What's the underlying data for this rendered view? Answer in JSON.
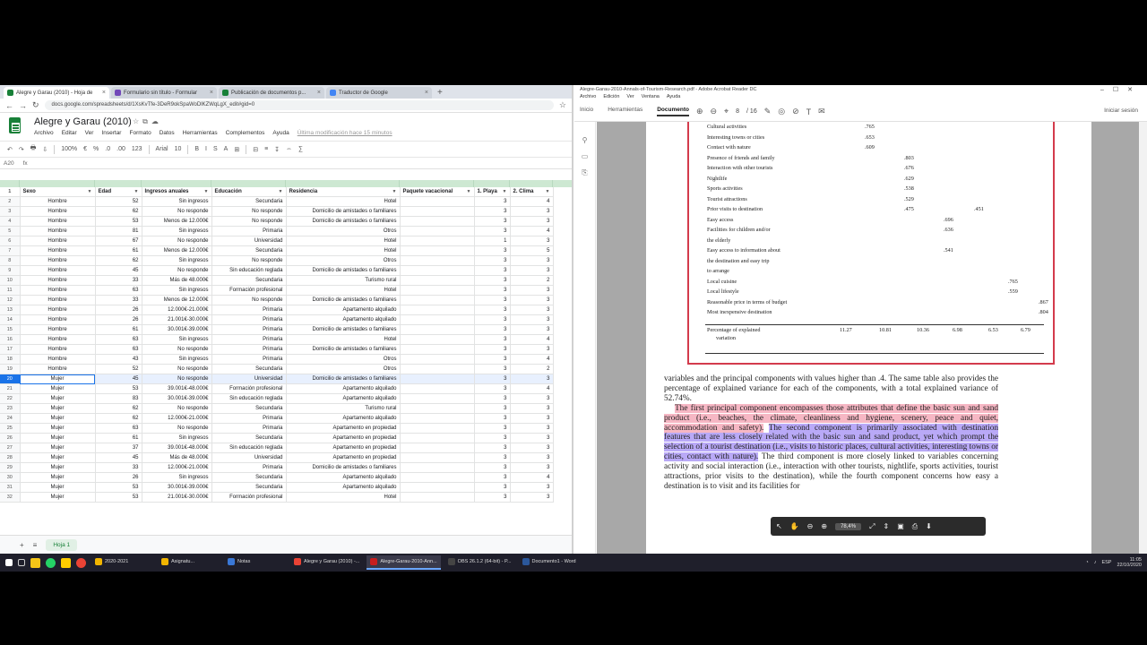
{
  "browser": {
    "tabs": [
      {
        "label": "Alegre y Garau (2010) - Hoja de",
        "color": "#188038",
        "active": true
      },
      {
        "label": "Formulario sin título - Formular",
        "color": "#7248b9",
        "active": false
      },
      {
        "label": "Publicación de documentos p...",
        "color": "#188038",
        "active": false
      },
      {
        "label": "Traductor de Google",
        "color": "#4285f4",
        "active": false
      }
    ],
    "url": "docs.google.com/spreadsheets/d/1XsKvTfe-3DeR9okSpaWoDlKZWqLgX_edit#gid=0"
  },
  "sheet": {
    "title": "Alegre y Garau (2010)",
    "menu": [
      "Archivo",
      "Editar",
      "Ver",
      "Insertar",
      "Formato",
      "Datos",
      "Herramientas",
      "Complementos",
      "Ayuda"
    ],
    "last_edit": "Última modificación hace 15 minutos",
    "toolbar": [
      "↶",
      "↷",
      "🖶",
      "⇩",
      "100%",
      "€",
      "%",
      ".0",
      ".00",
      "123",
      "Arial",
      "10",
      "B",
      "I",
      "S",
      "A",
      "⊞",
      "⊟",
      "≡",
      "↧",
      "⇔",
      "∑"
    ],
    "cell_ref": "A20",
    "columns": [
      "Sexo",
      "Edad",
      "Ingresos anuales",
      "Educación",
      "Residencia",
      "Paquete vacacional",
      "1. Playa",
      "2. Clima"
    ],
    "rows": [
      [
        "Hombre",
        "52",
        "Sin ingresos",
        "Secundaria",
        "Hotel",
        "",
        "3",
        "4"
      ],
      [
        "Hombre",
        "62",
        "No responde",
        "No responde",
        "Domicilio de amistades o familiares",
        "",
        "3",
        "3"
      ],
      [
        "Hombre",
        "53",
        "Menos de 12.000€",
        "No responde",
        "Domicilio de amistades o familiares",
        "",
        "3",
        "3"
      ],
      [
        "Hombre",
        "81",
        "Sin ingresos",
        "Primaria",
        "Otros",
        "",
        "3",
        "4"
      ],
      [
        "Hombre",
        "67",
        "No responde",
        "Universidad",
        "Hotel",
        "",
        "1",
        "3"
      ],
      [
        "Hombre",
        "61",
        "Menos de 12.000€",
        "Secundaria",
        "Hotel",
        "",
        "3",
        "5"
      ],
      [
        "Hombre",
        "62",
        "Sin ingresos",
        "No responde",
        "Otros",
        "",
        "3",
        "3"
      ],
      [
        "Hombre",
        "45",
        "No responde",
        "Sin educación reglada",
        "Domicilio de amistades o familiares",
        "",
        "3",
        "3"
      ],
      [
        "Hombre",
        "33",
        "Más de 48.000€",
        "Secundaria",
        "Turismo rural",
        "",
        "3",
        "2"
      ],
      [
        "Hombre",
        "63",
        "Sin ingresos",
        "Formación profesional",
        "Hotel",
        "",
        "3",
        "3"
      ],
      [
        "Hombre",
        "33",
        "Menos de 12.000€",
        "No responde",
        "Domicilio de amistades o familiares",
        "",
        "3",
        "3"
      ],
      [
        "Hombre",
        "26",
        "12.000€-21.000€",
        "Primaria",
        "Apartamento alquilado",
        "",
        "3",
        "3"
      ],
      [
        "Hombre",
        "26",
        "21.001€-30.000€",
        "Primaria",
        "Apartamento alquilado",
        "",
        "3",
        "3"
      ],
      [
        "Hombre",
        "61",
        "30.001€-39.000€",
        "Primaria",
        "Domicilio de amistades o familiares",
        "",
        "3",
        "3"
      ],
      [
        "Hombre",
        "63",
        "Sin ingresos",
        "Primaria",
        "Hotel",
        "",
        "3",
        "4"
      ],
      [
        "Hombre",
        "63",
        "No responde",
        "Primaria",
        "Domicilio de amistades o familiares",
        "",
        "3",
        "3"
      ],
      [
        "Hombre",
        "43",
        "Sin ingresos",
        "Primaria",
        "Otros",
        "",
        "3",
        "4"
      ],
      [
        "Hombre",
        "52",
        "No responde",
        "Secundaria",
        "Otros",
        "",
        "3",
        "2"
      ],
      [
        "Mujer",
        "45",
        "No responde",
        "Universidad",
        "Domicilio de amistades o familiares",
        "",
        "3",
        "3"
      ],
      [
        "Mujer",
        "53",
        "39.001€-48.000€",
        "Formación profesional",
        "Apartamento alquilado",
        "",
        "3",
        "4"
      ],
      [
        "Mujer",
        "83",
        "30.001€-39.000€",
        "Sin educación reglada",
        "Apartamento alquilado",
        "",
        "3",
        "3"
      ],
      [
        "Mujer",
        "62",
        "No responde",
        "Secundaria",
        "Turismo rural",
        "",
        "3",
        "3"
      ],
      [
        "Mujer",
        "62",
        "12.000€-21.000€",
        "Primaria",
        "Apartamento alquilado",
        "",
        "3",
        "3"
      ],
      [
        "Mujer",
        "63",
        "No responde",
        "Primaria",
        "Apartamento en propiedad",
        "",
        "3",
        "3"
      ],
      [
        "Mujer",
        "61",
        "Sin ingresos",
        "Secundaria",
        "Apartamento en propiedad",
        "",
        "3",
        "3"
      ],
      [
        "Mujer",
        "37",
        "39.001€-48.000€",
        "Sin educación reglada",
        "Apartamento en propiedad",
        "",
        "3",
        "3"
      ],
      [
        "Mujer",
        "45",
        "Más de 48.000€",
        "Universidad",
        "Apartamento en propiedad",
        "",
        "3",
        "3"
      ],
      [
        "Mujer",
        "33",
        "12.000€-21.000€",
        "Primaria",
        "Domicilio de amistades o familiares",
        "",
        "3",
        "3"
      ],
      [
        "Mujer",
        "26",
        "Sin ingresos",
        "Secundaria",
        "Apartamento alquilado",
        "",
        "3",
        "4"
      ],
      [
        "Mujer",
        "53",
        "30.001€-39.000€",
        "Secundaria",
        "Apartamento alquilado",
        "",
        "3",
        "3"
      ],
      [
        "Mujer",
        "53",
        "21.001€-30.000€",
        "Formación profesional",
        "Hotel",
        "",
        "3",
        "3"
      ]
    ],
    "selected_row": 20,
    "sheet_tab": "Hoja 1"
  },
  "pdf": {
    "title": "Alegre-Garau-2010-Annals-of-Tourism-Research.pdf - Adobe Acrobat Reader DC",
    "menu": [
      "Archivo",
      "Edición",
      "Ver",
      "Ventana",
      "Ayuda"
    ],
    "tabs": [
      "Inicio",
      "Herramientas",
      "Documento"
    ],
    "page_num": "8",
    "page_total": "/ 16",
    "signin": "Iniciar sesión",
    "zoom": "78,4%",
    "table_rows": [
      {
        "label": "Cultural activities",
        "vals": [
          ".765",
          "",
          "",
          "",
          "",
          ""
        ]
      },
      {
        "label": "Interesting towns or cities",
        "vals": [
          ".653",
          "",
          "",
          "",
          "",
          ""
        ]
      },
      {
        "label": "Contact with nature",
        "vals": [
          ".609",
          "",
          "",
          "",
          "",
          ""
        ]
      },
      {
        "label": "Presence of friends and family",
        "vals": [
          "",
          ".803",
          "",
          "",
          "",
          ""
        ]
      },
      {
        "label": "Interaction with other tourists",
        "vals": [
          "",
          ".676",
          "",
          "",
          "",
          ""
        ]
      },
      {
        "label": "Nightlife",
        "vals": [
          "",
          ".629",
          "",
          "",
          "",
          ""
        ]
      },
      {
        "label": "Sports activities",
        "vals": [
          "",
          ".538",
          "",
          "",
          "",
          ""
        ]
      },
      {
        "label": "Tourist attractions",
        "vals": [
          "",
          ".529",
          "",
          "",
          "",
          ""
        ]
      },
      {
        "label": "Prior visits to destination",
        "vals": [
          "",
          ".475",
          "",
          ".451",
          "",
          ""
        ]
      },
      {
        "label": "Easy access",
        "vals": [
          "",
          "",
          ".696",
          "",
          "",
          ""
        ]
      },
      {
        "label": "Facilities for children and/or",
        "vals": [
          "",
          "",
          ".636",
          "",
          "",
          ""
        ]
      },
      {
        "label": "  the elderly",
        "vals": [
          "",
          "",
          "",
          "",
          "",
          ""
        ]
      },
      {
        "label": "Easy access to information about",
        "vals": [
          "",
          "",
          ".541",
          "",
          "",
          ""
        ]
      },
      {
        "label": "  the destination and easy trip",
        "vals": [
          "",
          "",
          "",
          "",
          "",
          ""
        ]
      },
      {
        "label": "  to arrange",
        "vals": [
          "",
          "",
          "",
          "",
          "",
          ""
        ]
      },
      {
        "label": "Local cuisine",
        "vals": [
          "",
          "",
          "",
          "",
          ".765",
          ""
        ]
      },
      {
        "label": "Local lifestyle",
        "vals": [
          "",
          "",
          "",
          "",
          ".559",
          ""
        ]
      },
      {
        "label": "Reasonable price in terms of budget",
        "vals": [
          "",
          "",
          "",
          "",
          "",
          ".867"
        ]
      },
      {
        "label": "Most inexpensive destination",
        "vals": [
          "",
          "",
          "",
          "",
          "",
          ".804"
        ]
      }
    ],
    "variance_label_1": "Percentage of explained",
    "variance_label_2": "variation",
    "variance_vals": [
      "11.27",
      "10.81",
      "10.36",
      "6.98",
      "6.53",
      "6.79"
    ],
    "para1": "variables and the principal components with values higher than .4. The same table also provides the percentage of explained variance for each of the components, with a total explained variance of 52.74%.",
    "para2_pink": "The first principal component encompasses those attributes that define the basic sun and sand product (i.e., beaches, the climate, cleanliness and hygiene, scenery, peace and quiet, accommodation and safety).",
    "para2_blue": "The second component is primarily associated with destination features that are less closely related with the basic sun and sand product, yet which prompt the selection of a tourist destination (i.e., visits to historic places, cultural activities, interesting towns or cities, contact with nature).",
    "para2_rest": "The third component is more closely linked to variables concerning activity and social interaction (i.e., interaction with other tourists, nightlife, sports activities, tourist attractions, prior visits to the destination), while the fourth component concerns how easy a destination is to visit and its facilities for"
  },
  "taskbar": {
    "apps": [
      {
        "label": "2020-2021",
        "color": "#f0b400",
        "active": false
      },
      {
        "label": "Asignatu...",
        "color": "#f0b400",
        "active": false
      },
      {
        "label": "Notas",
        "color": "#3a78d6",
        "active": false
      },
      {
        "label": "Alegre y Garau (2010) -...",
        "color": "#ea4335",
        "active": false
      },
      {
        "label": "Alegre-Garau-2010-Ann...",
        "color": "#c81e1e",
        "active": true
      },
      {
        "label": "OBS 26.1.2 (64-bit) - P...",
        "color": "#444444",
        "active": false
      },
      {
        "label": "Documento1 - Word",
        "color": "#2b579a",
        "active": false
      }
    ],
    "tray": "ESP",
    "time": "11:05",
    "date": "22/10/2020"
  }
}
